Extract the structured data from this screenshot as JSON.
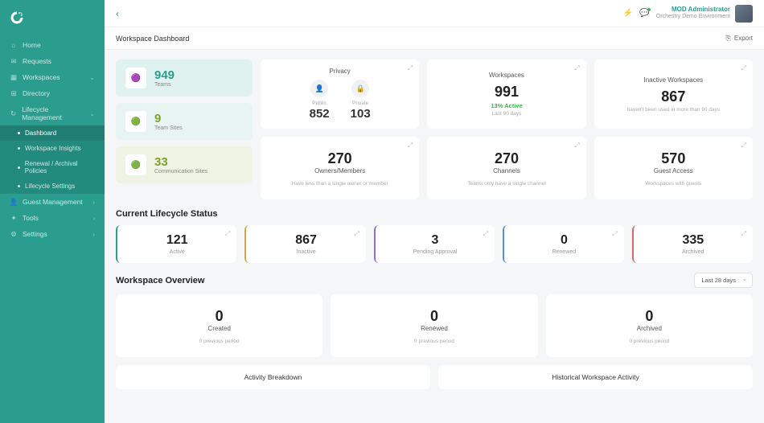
{
  "user": {
    "name": "MOD Administrator",
    "env": "Orchestry Demo Environment"
  },
  "nav": {
    "home": "Home",
    "requests": "Requests",
    "workspaces": "Workspaces",
    "directory": "Directory",
    "lifecycle": "Lifecycle Management",
    "dashboard": "Dashboard",
    "insights": "Workspace Insights",
    "policies": "Renewal / Archival Policies",
    "settings_lc": "Lifecycle Settings",
    "guest": "Guest Management",
    "tools": "Tools",
    "settings": "Settings"
  },
  "page": {
    "title": "Workspace Dashboard",
    "export": "Export"
  },
  "tiles": {
    "teams": {
      "num": "949",
      "label": "Teams"
    },
    "sites": {
      "num": "9",
      "label": "Team Sites"
    },
    "comm": {
      "num": "33",
      "label": "Communication Sites"
    }
  },
  "cards": {
    "privacy": {
      "title": "Privacy",
      "public_lbl": "Public",
      "public_num": "852",
      "private_lbl": "Private",
      "private_num": "103"
    },
    "workspaces": {
      "title": "Workspaces",
      "num": "991",
      "active": "13% Active",
      "sub": "Last 90 days"
    },
    "inactive": {
      "title": "Inactive Workspaces",
      "num": "867",
      "sub": "haven't been used in more than 90 days"
    },
    "owners": {
      "title": "Owners/Members",
      "num": "270",
      "sub": "Have less than a single owner or member"
    },
    "channels": {
      "title": "Channels",
      "num": "270",
      "sub": "Teams only have a single channel"
    },
    "guest": {
      "title": "Guest Access",
      "num": "570",
      "sub": "Workspaces with guests"
    }
  },
  "lifecycle": {
    "heading": "Current Lifecycle Status",
    "active": {
      "num": "121",
      "lbl": "Active"
    },
    "inactive": {
      "num": "867",
      "lbl": "Inactive"
    },
    "pending": {
      "num": "3",
      "lbl": "Pending Approval"
    },
    "renewed": {
      "num": "0",
      "lbl": "Renewed"
    },
    "archived": {
      "num": "335",
      "lbl": "Archived"
    }
  },
  "overview": {
    "heading": "Workspace Overview",
    "range": "Last 28 days",
    "created": {
      "num": "0",
      "lbl": "Created",
      "sub": "0 previous period"
    },
    "renewed": {
      "num": "0",
      "lbl": "Renewed",
      "sub": "0 previous period"
    },
    "archived": {
      "num": "0",
      "lbl": "Archived",
      "sub": "0 previous period"
    }
  },
  "activity": {
    "breakdown": "Activity Breakdown",
    "historical": "Historical Workspace Activity"
  }
}
